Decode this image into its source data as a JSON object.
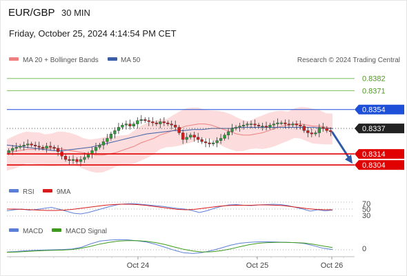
{
  "header": {
    "symbol": "EUR/GBP",
    "timeframe": "30 MIN",
    "datetime": "Friday, October 25, 2024 4:14:54 PM CET"
  },
  "legend": {
    "ma20_label": "MA 20 + Bollinger Bands",
    "ma50_label": "MA 50",
    "copyright": "Research © 2024 Trading Central"
  },
  "rsi_legend": {
    "rsi_label": "RSI",
    "ma_label": "9MA"
  },
  "macd_legend": {
    "macd_label": "MACD",
    "signal_label": "MACD Signal"
  },
  "colors": {
    "bull": "#2e9c3c",
    "bear": "#d81b1b",
    "ma20": "#f08080",
    "ma50": "#3b5ea8",
    "bands": "#fbd3d3",
    "resistance": "#7cbf5a",
    "resistance_text": "#4c9a1c",
    "pivot": "#1d4fd8",
    "support": "#e00000",
    "rsi": "#5b7fd8",
    "macd": "#5b7fd8",
    "macd_signal": "#3d9a1c",
    "arrow": "#2f5aa8"
  },
  "chart_data": {
    "type": "candlestick",
    "price_levels": {
      "resistance": [
        0.8382,
        0.8371
      ],
      "pivot": 0.8354,
      "last": 0.8337,
      "support": [
        0.8314,
        0.8304
      ]
    },
    "price_level_labels": [
      "0.8382",
      "0.8371",
      "0.8354",
      "0.8337",
      "0.8314",
      "0.8304"
    ],
    "x_labels": [
      "Oct 24",
      "Oct 25",
      "Oct 26"
    ],
    "y_range": [
      0.8296,
      0.8393
    ],
    "rsi_levels": [
      "70",
      "50",
      "30"
    ],
    "macd_zero_label": "0",
    "closes": [
      0.8317,
      0.8319,
      0.832,
      0.8321,
      0.8322,
      0.8323,
      0.8322,
      0.8321,
      0.832,
      0.8319,
      0.8321,
      0.832,
      0.8319,
      0.8316,
      0.8312,
      0.8309,
      0.8308,
      0.8309,
      0.8307,
      0.8309,
      0.8311,
      0.8314,
      0.8317,
      0.832,
      0.8322,
      0.8325,
      0.8328,
      0.8332,
      0.8335,
      0.8338,
      0.834,
      0.8341,
      0.8339,
      0.8341,
      0.8344,
      0.8345,
      0.8344,
      0.8343,
      0.8342,
      0.8341,
      0.8343,
      0.8342,
      0.8341,
      0.834,
      0.8338,
      0.8333,
      0.8327,
      0.8329,
      0.8331,
      0.8329,
      0.8327,
      0.8325,
      0.8324,
      0.8323,
      0.8324,
      0.8326,
      0.8328,
      0.8331,
      0.8334,
      0.8337,
      0.8338,
      0.8339,
      0.834,
      0.8341,
      0.8341,
      0.834,
      0.8339,
      0.8339,
      0.8338,
      0.834,
      0.8341,
      0.8342,
      0.8342,
      0.8341,
      0.834,
      0.8341,
      0.834,
      0.8339,
      0.8335,
      0.8333,
      0.8332,
      0.8333,
      0.8338,
      0.8337,
      0.8335,
      0.8334
    ],
    "ma20": [
      0.8315,
      0.8316,
      0.8317,
      0.8318,
      0.8318,
      0.8319,
      0.8319,
      0.8319,
      0.8319,
      0.8318,
      0.8317,
      0.8316,
      0.8315,
      0.8314,
      0.8313,
      0.8313,
      0.8314,
      0.8315,
      0.8317,
      0.8319,
      0.8321,
      0.8324,
      0.8326,
      0.8328,
      0.8331,
      0.8333,
      0.8335,
      0.8337,
      0.8339,
      0.834,
      0.8341,
      0.8341,
      0.834,
      0.8338,
      0.8336,
      0.8334,
      0.8332,
      0.8331,
      0.8331,
      0.8332,
      0.8333,
      0.8335,
      0.8337,
      0.8339,
      0.834,
      0.8341,
      0.8341,
      0.834,
      0.8339,
      0.8339,
      0.8338,
      0.8337
    ],
    "ma50": [
      0.8322,
      0.8321,
      0.832,
      0.8319,
      0.8318,
      0.8317,
      0.8317,
      0.8318,
      0.8319,
      0.832,
      0.8322,
      0.8324,
      0.8326,
      0.8328,
      0.833,
      0.8332,
      0.8333,
      0.8334,
      0.8335,
      0.8335,
      0.8336,
      0.8336,
      0.8337,
      0.8337,
      0.8337,
      0.8338,
      0.8338,
      0.8338,
      0.8338,
      0.8338,
      0.8338,
      0.8338,
      0.8338,
      0.8338,
      0.8337,
      0.8337
    ],
    "rsi": [
      45,
      48,
      50,
      47,
      49,
      52,
      55,
      50,
      44,
      38,
      36,
      40,
      46,
      52,
      58,
      63,
      65,
      66,
      64,
      62,
      60,
      58,
      55,
      52,
      50,
      46,
      40,
      45,
      52,
      58,
      62,
      63,
      61,
      60,
      62,
      63,
      64,
      63,
      60,
      55,
      50,
      44,
      48,
      45,
      47
    ],
    "rsi_ma": [
      50,
      50,
      49,
      48,
      47,
      46,
      46,
      47,
      49,
      52,
      55,
      58,
      61,
      63,
      64,
      64,
      63,
      61,
      58,
      55,
      52,
      49,
      48,
      49,
      52,
      55,
      58,
      60,
      61,
      61,
      61,
      62,
      62,
      61,
      60,
      57,
      54,
      51,
      49,
      48,
      48
    ],
    "macd": [
      -0.9,
      -0.7,
      -0.4,
      -0.2,
      -0.1,
      0.0,
      0.1,
      0.3,
      1.0,
      2.4,
      3.5,
      3.9,
      4.1,
      4.0,
      3.6,
      3.1,
      2.2,
      1.0,
      -0.2,
      -1.2,
      -1.5,
      -1.1,
      -0.3,
      0.7,
      1.8,
      2.6,
      3.0,
      3.2,
      3.2,
      3.1,
      3.0,
      2.9,
      2.5,
      1.6,
      0.6,
      0.1
    ],
    "macd_signal": [
      -1.0,
      -0.9,
      -0.7,
      -0.5,
      -0.3,
      -0.2,
      -0.1,
      0.1,
      0.6,
      1.4,
      2.3,
      3.0,
      3.5,
      3.7,
      3.7,
      3.4,
      2.9,
      2.1,
      1.1,
      0.2,
      -0.5,
      -0.9,
      -0.8,
      -0.4,
      0.3,
      1.2,
      2.0,
      2.6,
      2.9,
      3.0,
      3.0,
      2.9,
      2.7,
      2.2,
      1.5,
      0.9
    ]
  }
}
